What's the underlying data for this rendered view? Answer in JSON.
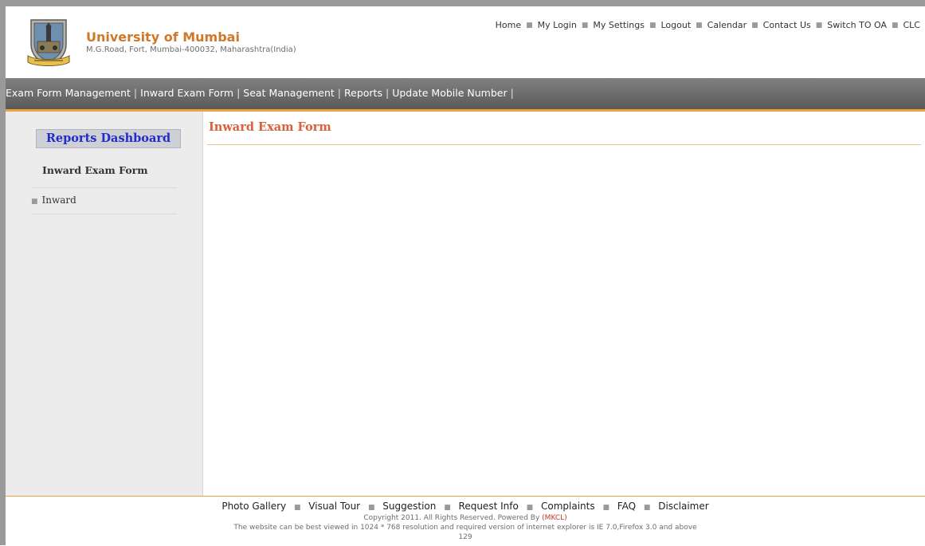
{
  "header": {
    "university_name": "University of Mumbai",
    "address": "M.G.Road, Fort, Mumbai-400032, Maharashtra(India)",
    "top_links": [
      "Home",
      "My Login",
      "My Settings",
      "Logout",
      "Calendar",
      "Contact Us",
      "Switch TO OA",
      "CLC"
    ]
  },
  "navbar": {
    "items": [
      "Exam Form Management",
      "Inward Exam Form",
      "Seat Management",
      "Reports",
      "Update Mobile Number"
    ]
  },
  "sidebar": {
    "dashboard_button": "Reports Dashboard",
    "heading": "Inward Exam Form",
    "items": [
      "Inward"
    ]
  },
  "main": {
    "title": "Inward Exam Form"
  },
  "footer": {
    "links": [
      "Photo Gallery",
      "Visual Tour",
      "Suggestion",
      "Request Info",
      "Complaints",
      "FAQ",
      "Disclaimer"
    ],
    "copyright_prefix": "Copyright 2011. All Rights Reserved. Powered By",
    "powered_by": "(MKCL)",
    "resolution_note": "The website can be best viewed in 1024 * 768 resolution and required version of internet explorer is IE 7.0,Firefox 3.0 and above",
    "counter": "129"
  },
  "colors": {
    "brand": "#d0782a",
    "accent_border": "#e8a638",
    "title": "#d9603c",
    "dashboard_text": "#1f2cc8"
  },
  "icons": {
    "logo": "university-emblem",
    "bullet": "square-bullet"
  }
}
